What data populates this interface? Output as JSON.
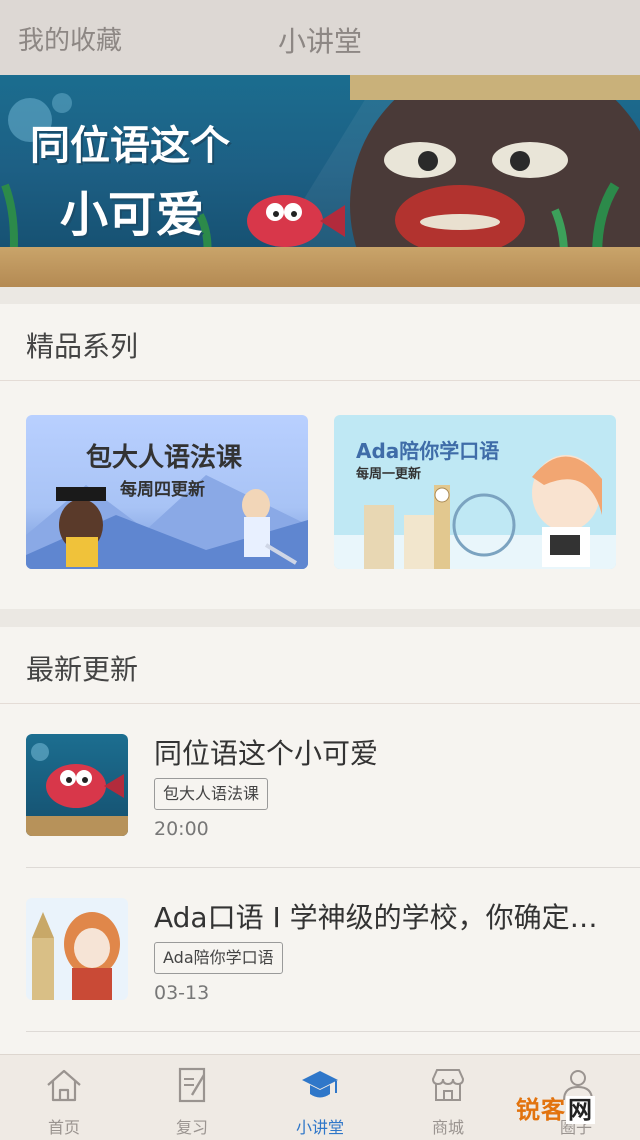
{
  "topbar": {
    "left": "我的收藏",
    "title": "小讲堂"
  },
  "banner": {
    "line1": "同位语这个",
    "line2": "小可爱"
  },
  "series_section": {
    "heading": "精品系列",
    "cards": [
      {
        "title": "包大人语法课",
        "subtitle": "每周四更新"
      },
      {
        "title": "Ada陪你学口语",
        "subtitle": "每周一更新"
      }
    ]
  },
  "latest_section": {
    "heading": "最新更新",
    "items": [
      {
        "title": "同位语这个小可爱",
        "tag": "包大人语法课",
        "time": "20:00"
      },
      {
        "title": "Ada口语 I 学神级的学校，你确定…",
        "tag": "Ada陪你学口语",
        "time": "03-13"
      }
    ]
  },
  "tabbar": {
    "tabs": [
      {
        "label": "首页",
        "icon": "home-icon"
      },
      {
        "label": "复习",
        "icon": "notebook-icon"
      },
      {
        "label": "小讲堂",
        "icon": "graduation-cap-icon"
      },
      {
        "label": "商城",
        "icon": "shop-icon"
      },
      {
        "label": "圈子",
        "icon": "people-icon"
      }
    ],
    "active_color": "#2f77c9",
    "inactive_color": "#9a9490"
  },
  "watermark": {
    "text": "锐客",
    "text2": "网"
  }
}
